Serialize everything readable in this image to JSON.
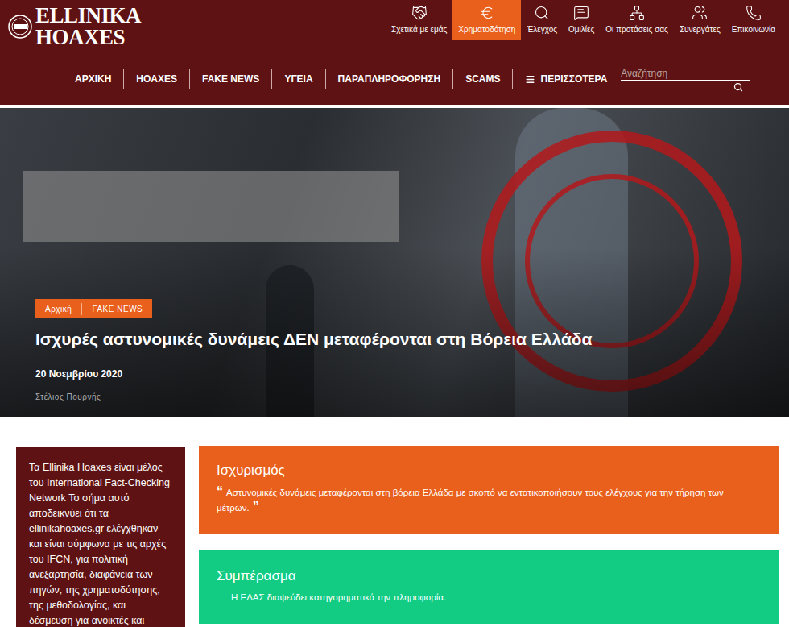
{
  "logo": {
    "line1": "ELLINIKA",
    "line2": "HOAXES"
  },
  "top_menu": [
    {
      "label": "Σχετικά με εμάς",
      "icon": "about",
      "selected": false
    },
    {
      "label": "Χρηματοδότηση",
      "icon": "funding",
      "selected": true
    },
    {
      "label": "Έλεγχος",
      "icon": "check",
      "selected": false
    },
    {
      "label": "Ομιλίες",
      "icon": "talks",
      "selected": false
    },
    {
      "label": "Οι προτάσεις σας",
      "icon": "suggestions",
      "selected": false
    },
    {
      "label": "Συνεργάτες",
      "icon": "partners",
      "selected": false
    },
    {
      "label": "Επικοινωνία",
      "icon": "contact",
      "selected": false
    }
  ],
  "nav": [
    {
      "label": "ΑΡΧΙΚΗ",
      "kind": "link"
    },
    {
      "label": "HOAXES",
      "kind": "link"
    },
    {
      "label": "FAKE NEWS",
      "kind": "link"
    },
    {
      "label": "ΥΓΕΙΑ",
      "kind": "link"
    },
    {
      "label": "ΠΑΡΑΠΛΗΡΟΦΟΡΗΣΗ",
      "kind": "link"
    },
    {
      "label": "SCAMS",
      "kind": "link"
    },
    {
      "label": "ΠΕΡΙΣΣΟΤΕΡΑ",
      "kind": "menu"
    }
  ],
  "search": {
    "placeholder": "Αναζήτηση"
  },
  "article": {
    "tags": [
      "Αρχική",
      "FAKE NEWS"
    ],
    "title": "Ισχυρές αστυνομικές δυνάμεις ΔΕΝ μεταφέρονται στη Βόρεια Ελλάδα",
    "date": "20 Νοεμβρίου 2020",
    "author": "Στέλιος Πουρνής"
  },
  "sidebar": {
    "text": "Τα Ellinika Hoaxes είναι μέλος του International Fact-Checking Network Το σήμα αυτό αποδεικνύει ότι τα ellinikahoaxes.gr ελέγχθηκαν και είναι σύμφωνα με τις αρχές του IFCN, για πολιτική ανεξαρτησία, διαφάνεια των πηγών, της χρηματοδότησης, της μεθοδολογίας, και δέσμευση για ανοικτές και"
  },
  "claim": {
    "title": "Ισχυρισμός",
    "quote_open": "“",
    "text": "Αστυνομικές δυνάμεις μεταφέρονται στη βόρεια Ελλάδα με σκοπό να εντατικοποιήσουν τους ελέγχους για την τήρηση των μέτρων.",
    "quote_close": "”"
  },
  "conclusion": {
    "title": "Συμπέρασμα",
    "text": "Η ΕΛΑΣ διαψεύδει κατηγορηματικά την πληροφορία."
  }
}
